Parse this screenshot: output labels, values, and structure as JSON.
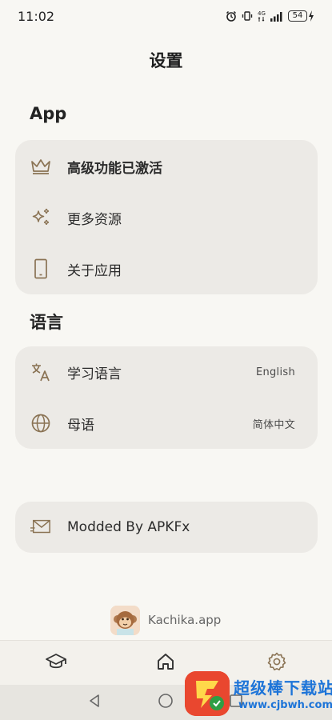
{
  "status_bar": {
    "time": "11:02",
    "network": "4G",
    "battery": "54"
  },
  "page_title": "设置",
  "sections": {
    "app": {
      "title": "App",
      "items": [
        {
          "label": "高级功能已激活",
          "icon": "crown-icon"
        },
        {
          "label": "更多资源",
          "icon": "sparkles-icon"
        },
        {
          "label": "关于应用",
          "icon": "phone-icon"
        }
      ]
    },
    "language": {
      "title": "语言",
      "items": [
        {
          "label": "学习语言",
          "value": "English",
          "icon": "translate-icon"
        },
        {
          "label": "母语",
          "value": "简体中文",
          "icon": "globe-icon"
        }
      ]
    },
    "extra": {
      "items": [
        {
          "label": "Modded By APKFx",
          "icon": "mail-icon"
        }
      ]
    }
  },
  "footer": {
    "brand": "Kachika.app"
  },
  "bottom_nav": [
    {
      "icon": "graduation-cap-icon"
    },
    {
      "icon": "home-icon"
    },
    {
      "icon": "gear-icon"
    }
  ],
  "watermark": {
    "title": "超级棒下载站",
    "url": "www.cjbwh.com"
  },
  "colors": {
    "background": "#f8f7f3",
    "card": "#eceae6",
    "icon_accent": "#8a7354"
  }
}
